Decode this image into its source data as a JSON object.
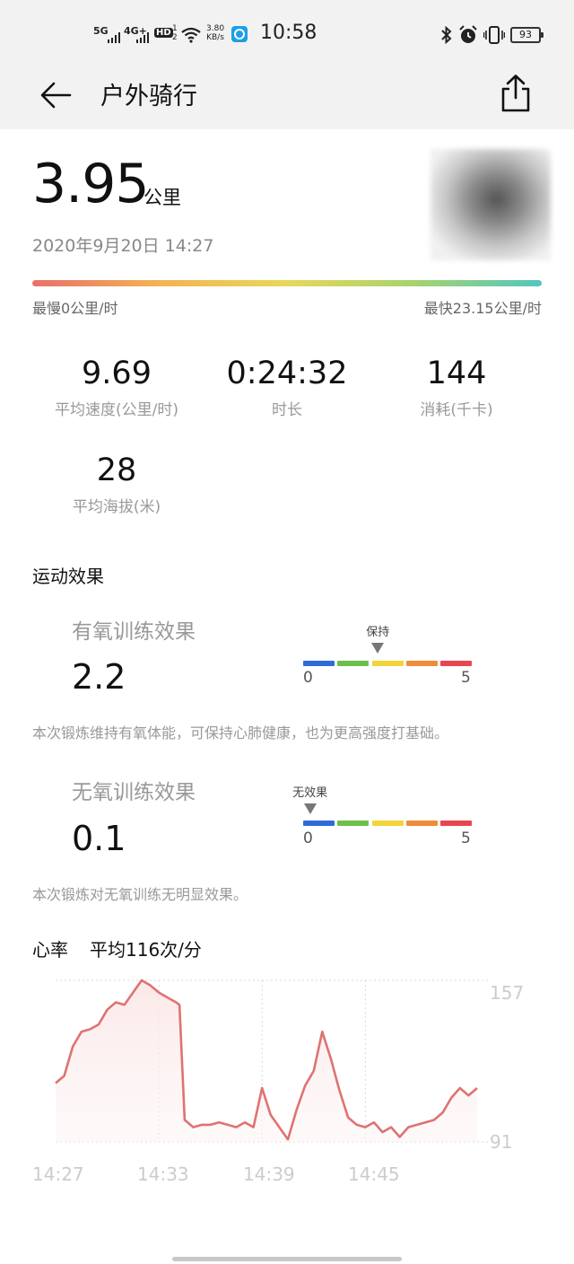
{
  "status_bar": {
    "sim1": "5G",
    "sim2": "4G+",
    "hd": "HD",
    "hd_sub": "1",
    "hd_sub2": "2",
    "net_speed_value": "3.80",
    "net_speed_unit": "KB/s",
    "time": "10:58",
    "battery": "93"
  },
  "app_bar": {
    "title": "户外骑行"
  },
  "summary": {
    "distance": "3.95",
    "distance_unit": "公里",
    "date": "2020年9月20日 14:27",
    "speed_min": "最慢0公里/时",
    "speed_max": "最快23.15公里/时"
  },
  "stats": [
    {
      "value": "9.69",
      "label": "平均速度(公里/时)"
    },
    {
      "value": "0:24:32",
      "label": "时长"
    },
    {
      "value": "144",
      "label": "消耗(千卡)"
    },
    {
      "value": "28",
      "label": "平均海拔(米)"
    }
  ],
  "effect": {
    "section_title": "运动效果",
    "aerobic": {
      "name": "有氧训练效果",
      "value": "2.2",
      "level": 2.2,
      "marker_label": "保持",
      "scale_min": "0",
      "scale_max": "5",
      "description": "本次锻炼维持有氧体能，可保持心肺健康，也为更高强度打基础。"
    },
    "anaerobic": {
      "name": "无氧训练效果",
      "value": "0.1",
      "level": 0.1,
      "marker_label": "无效果",
      "scale_min": "0",
      "scale_max": "5",
      "description": "本次锻炼对无氧训练无明显效果。"
    },
    "scale_colors": [
      "#2f6bd8",
      "#6cc04a",
      "#f2d43a",
      "#f08b3a",
      "#e8454f"
    ]
  },
  "heart_rate": {
    "title": "心率",
    "avg_label": "平均116次/分",
    "line_color": "#e07272"
  },
  "chart_data": {
    "type": "area",
    "title": "",
    "xlabel": "",
    "ylabel": "",
    "x_ticks": [
      "14:27",
      "14:33",
      "14:39",
      "14:45"
    ],
    "y_ticks": [
      "157",
      "91"
    ],
    "ylim": [
      91,
      157
    ],
    "xlim_minutes": [
      0,
      24.5
    ],
    "series": [
      {
        "x_minutes": [
          0,
          0.5,
          1,
          1.5,
          2,
          2.5,
          3,
          3.5,
          4,
          4.5,
          5,
          5.5,
          6,
          6.5,
          7,
          7.2,
          7.5,
          8,
          8.5,
          9,
          9.5,
          10,
          10.5,
          11,
          11.5,
          12,
          12.5,
          13,
          13.5,
          14,
          14.5,
          15,
          15.5,
          16,
          16.5,
          17,
          17.5,
          18,
          18.5,
          19,
          19.5,
          20,
          20.5,
          21,
          21.5,
          22,
          22.5,
          23,
          23.5,
          24,
          24.5
        ],
        "values": [
          115,
          118,
          130,
          136,
          137,
          139,
          145,
          148,
          147,
          152,
          157,
          155,
          152,
          150,
          148,
          147,
          100,
          97,
          98,
          98,
          99,
          98,
          97,
          99,
          97,
          113,
          102,
          97,
          92,
          104,
          114,
          120,
          136,
          125,
          112,
          101,
          98,
          97,
          99,
          95,
          97,
          93,
          97,
          98,
          99,
          100,
          103,
          109,
          113,
          110,
          113
        ]
      }
    ]
  }
}
